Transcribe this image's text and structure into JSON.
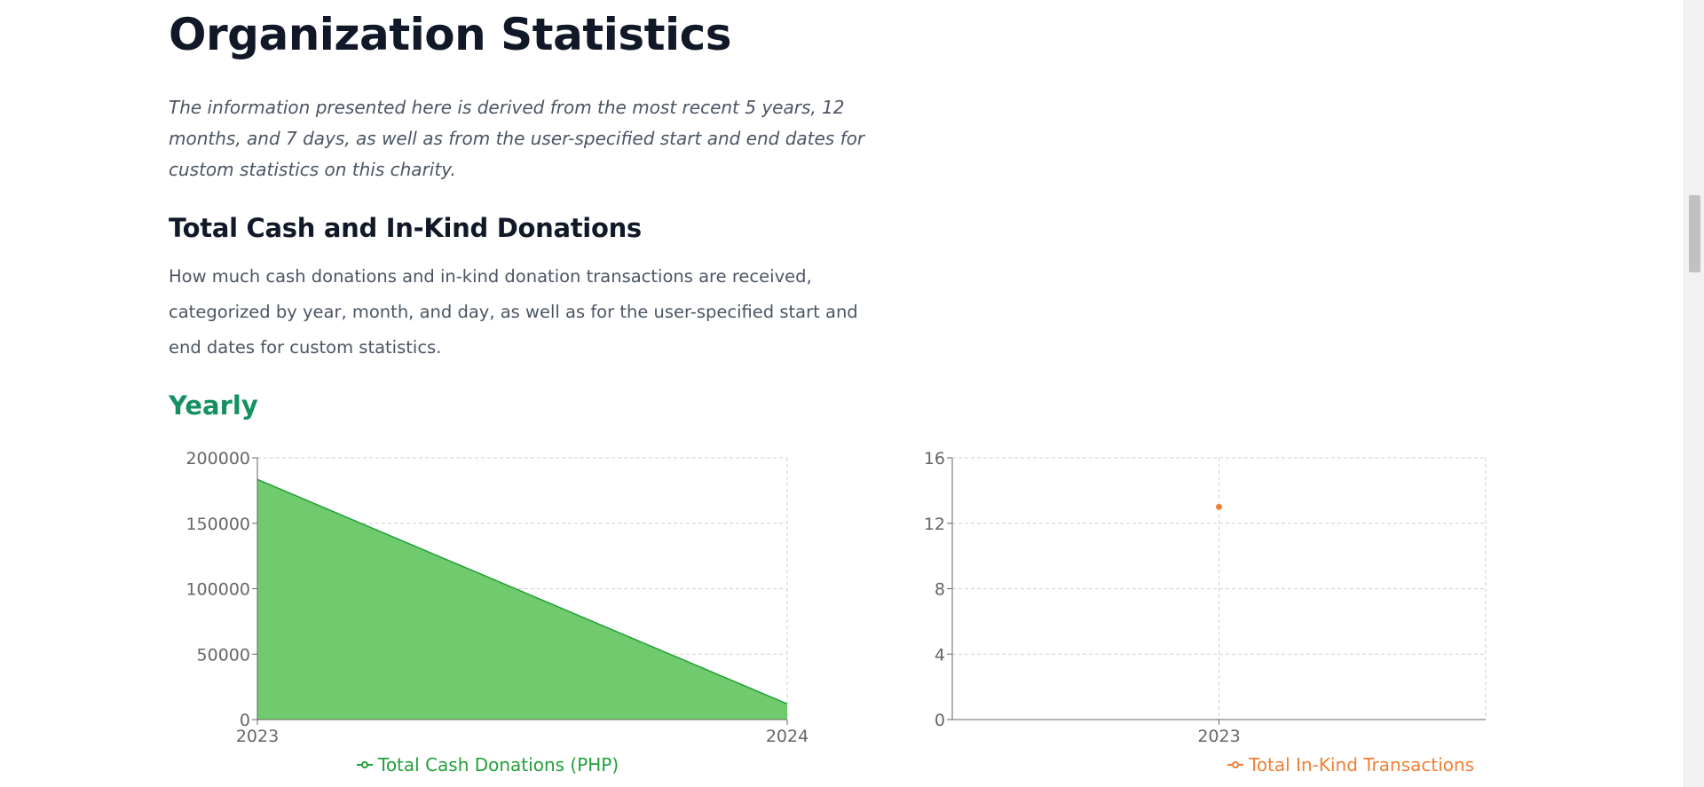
{
  "page": {
    "title": "Organization Statistics",
    "intro": "The information presented here is derived from the most recent 5 years, 12 months, and 7 days, as well as from the user-specified start and end dates for custom statistics on this charity."
  },
  "section": {
    "title": "Total Cash and In-Kind Donations",
    "description": "How much cash donations and in-kind donation transactions are received, categorized by year, month, and day, as well as for the user-specified start and end dates for custom statistics.",
    "period": "Yearly"
  },
  "colors": {
    "cash_line": "#22a03a",
    "cash_fill": "#6fcb6d",
    "inkind": "#f07f35",
    "heading_green": "#15915f"
  },
  "chart_data": [
    {
      "type": "area",
      "x": [
        "2023",
        "2024"
      ],
      "series": [
        {
          "name": "Total Cash Donations (PHP)",
          "values": [
            183500,
            12000
          ]
        }
      ],
      "yticks": [
        0,
        50000,
        100000,
        150000,
        200000
      ],
      "ylim": [
        0,
        200000
      ],
      "grid": true,
      "legend": "bottom"
    },
    {
      "type": "scatter",
      "x": [
        "2023"
      ],
      "series": [
        {
          "name": "Total In-Kind Transactions",
          "values": [
            13
          ]
        }
      ],
      "yticks": [
        0,
        4,
        8,
        12,
        16
      ],
      "ylim": [
        0,
        16
      ],
      "grid": true,
      "legend": "bottom"
    }
  ]
}
